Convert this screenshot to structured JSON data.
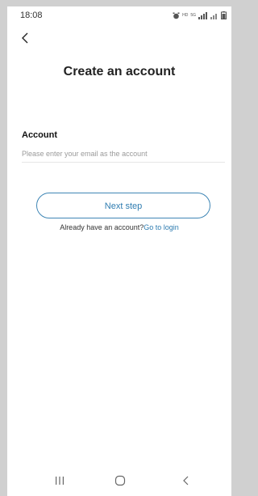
{
  "status_bar": {
    "time": "18:08",
    "network_label": "5G",
    "icons": [
      "alarm-icon",
      "hd-icon",
      "signal-icon",
      "battery-icon"
    ]
  },
  "header": {
    "back_icon": "chevron-left-icon",
    "title": "Create an account"
  },
  "form": {
    "account_label": "Account",
    "email_placeholder": "Please enter your email as the account",
    "email_value": ""
  },
  "actions": {
    "next_step_label": "Next step",
    "login_prompt": "Already have an account?",
    "login_link": "Go to login"
  },
  "nav_bar": {
    "icons": [
      "recents-icon",
      "home-icon",
      "back-icon"
    ]
  },
  "colors": {
    "accent": "#2e7cb0",
    "border_accent": "#3f86b5",
    "title_text": "#222222",
    "placeholder": "#9a9a9a",
    "frame": "#d0d0d0"
  }
}
